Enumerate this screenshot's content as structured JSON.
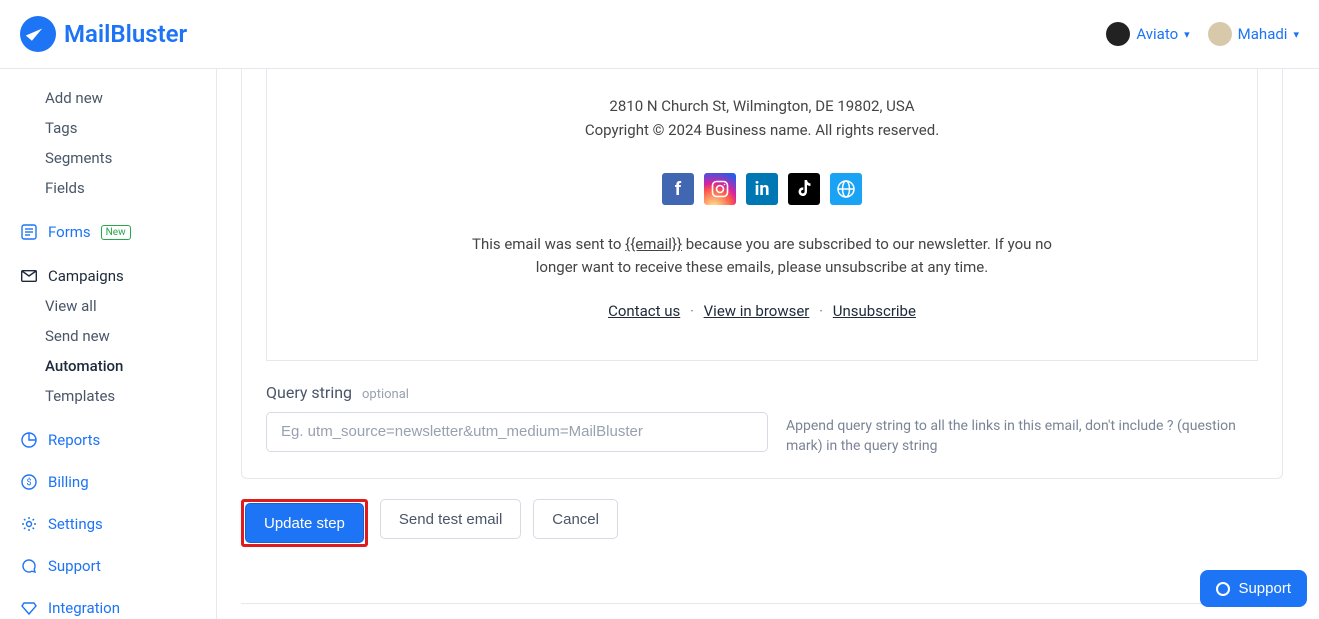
{
  "brand": {
    "name": "MailBluster"
  },
  "header": {
    "org_name": "Aviato",
    "user_name": "Mahadi"
  },
  "sidebar": {
    "add_new": "Add new",
    "tags": "Tags",
    "segments": "Segments",
    "fields": "Fields",
    "forms": "Forms",
    "forms_badge": "New",
    "campaigns": "Campaigns",
    "view_all": "View all",
    "send_new": "Send new",
    "automation": "Automation",
    "templates": "Templates",
    "reports": "Reports",
    "billing": "Billing",
    "settings": "Settings",
    "support": "Support",
    "integration": "Integration"
  },
  "preview": {
    "address": "2810 N Church St, Wilmington, DE 19802, USA",
    "copyright": "Copyright © 2024 Business name. All rights reserved.",
    "disclaimer_1": "This email was sent to ",
    "disclaimer_email": "{{email}}",
    "disclaimer_2": " because you are subscribed to our newsletter. If you no longer want to receive these emails, please unsubscribe at any time.",
    "contact": "Contact us",
    "view_browser": "View in browser",
    "unsubscribe": "Unsubscribe"
  },
  "query": {
    "label": "Query string",
    "optional": "optional",
    "placeholder": "Eg. utm_source=newsletter&utm_medium=MailBluster",
    "help": "Append query string to all the links in this email, don't include ? (question mark) in the query string"
  },
  "actions": {
    "update": "Update step",
    "test": "Send test email",
    "cancel": "Cancel"
  },
  "support_float": "Support"
}
